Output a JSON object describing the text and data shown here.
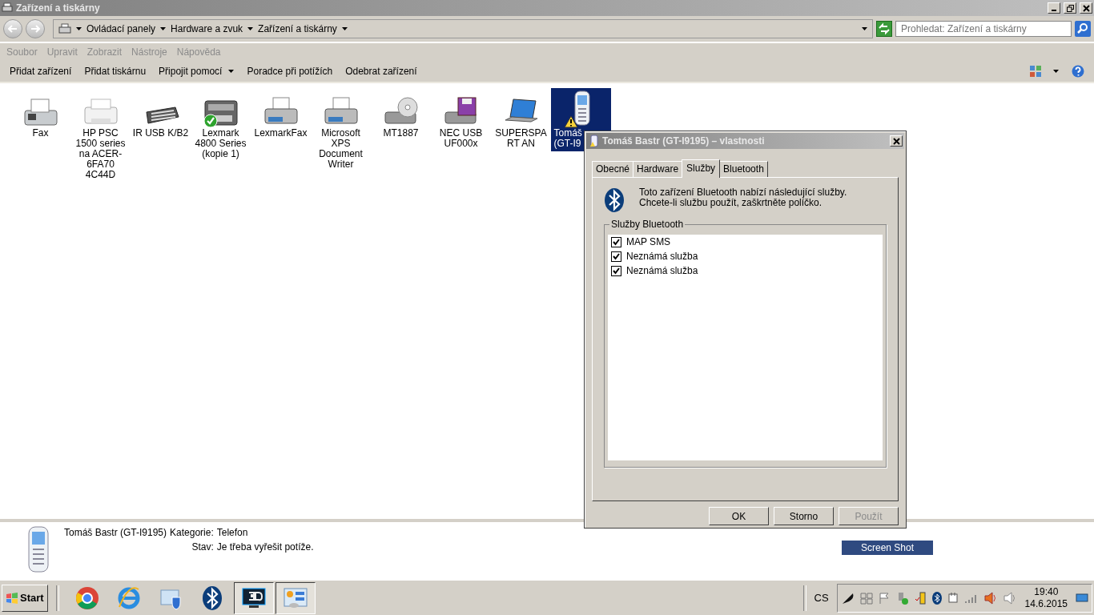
{
  "window": {
    "title": "Zařízení a tiskárny"
  },
  "breadcrumb": [
    "Ovládací panely",
    "Hardware a zvuk",
    "Zařízení a tiskárny"
  ],
  "search": {
    "placeholder": "Prohledat: Zařízení a tiskárny"
  },
  "menu": [
    "Soubor",
    "Upravit",
    "Zobrazit",
    "Nástroje",
    "Nápověda"
  ],
  "commands": [
    {
      "label": "Přidat zařízení",
      "has_menu": false
    },
    {
      "label": "Přidat tiskárnu",
      "has_menu": false
    },
    {
      "label": "Připojit pomocí",
      "has_menu": true
    },
    {
      "label": "Poradce při potížích",
      "has_menu": false
    },
    {
      "label": "Odebrat zařízení",
      "has_menu": false
    }
  ],
  "devices": [
    {
      "label": "Fax",
      "kind": "fax",
      "default": false,
      "warning": false,
      "selected": false
    },
    {
      "label": "HP PSC 1500 series na ACER-6FA70 4C44D",
      "kind": "inkjet",
      "default": false,
      "warning": false,
      "selected": false
    },
    {
      "label": "IR USB K/B2",
      "kind": "keyboard",
      "default": false,
      "warning": false,
      "selected": false
    },
    {
      "label": "Lexmark 4800 Series (kopie 1)",
      "kind": "multifunction",
      "default": true,
      "warning": false,
      "selected": false
    },
    {
      "label": "LexmarkFax",
      "kind": "printer",
      "default": false,
      "warning": false,
      "selected": false
    },
    {
      "label": "Microsoft XPS Document Writer",
      "kind": "printer",
      "default": false,
      "warning": false,
      "selected": false
    },
    {
      "label": "MT1887",
      "kind": "disc",
      "default": false,
      "warning": false,
      "selected": false
    },
    {
      "label": "NEC USB UF000x",
      "kind": "floppy",
      "default": false,
      "warning": false,
      "selected": false
    },
    {
      "label": "SUPERSPART AN",
      "kind": "laptop",
      "default": false,
      "warning": false,
      "selected": false
    },
    {
      "label": "Tomáš (GT-I9",
      "kind": "phone",
      "default": false,
      "warning": true,
      "selected": true
    }
  ],
  "details": {
    "name": "Tomáš Bastr (GT-I9195)",
    "fields": [
      {
        "label": "Kategorie:",
        "value": "Telefon"
      },
      {
        "label": "Stav:",
        "value": "Je třeba vyřešit potíže."
      }
    ]
  },
  "overlay_label": "Screen Shot",
  "dialog": {
    "title": "Tomáš Bastr (GT-I9195) – vlastnosti",
    "tabs": [
      {
        "label": "Obecné",
        "selected": false
      },
      {
        "label": "Hardware",
        "selected": false
      },
      {
        "label": "Služby",
        "selected": true
      },
      {
        "label": "Bluetooth",
        "selected": false
      }
    ],
    "description": "Toto zařízení Bluetooth nabízí následující služby. Chcete-li službu použít, zaškrtněte políčko.",
    "group_title": "Služby Bluetooth",
    "services": [
      {
        "label": "MAP SMS",
        "checked": true
      },
      {
        "label": "Neznámá služba",
        "checked": true
      },
      {
        "label": "Neznámá služba",
        "checked": true
      }
    ],
    "buttons": [
      {
        "label": "OK",
        "disabled": false
      },
      {
        "label": "Storno",
        "disabled": false
      },
      {
        "label": "Použít",
        "disabled": true
      }
    ]
  },
  "taskbar": {
    "start": "Start",
    "apps": [
      {
        "kind": "chrome",
        "active": false
      },
      {
        "kind": "ie",
        "active": false
      },
      {
        "kind": "security",
        "active": false
      },
      {
        "kind": "bluetooth",
        "active": false
      },
      {
        "kind": "monitor",
        "active": true
      },
      {
        "kind": "control-panel",
        "active": true
      }
    ],
    "language": "CS",
    "time": "19:40",
    "date": "14.6.2015"
  }
}
